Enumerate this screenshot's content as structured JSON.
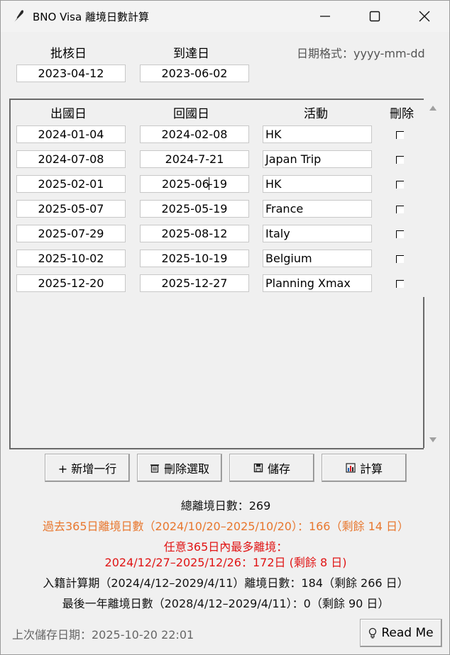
{
  "window": {
    "title": "BNO Visa 離境日數計算"
  },
  "header": {
    "approval_label": "批核日",
    "arrival_label": "到達日",
    "date_format_hint": "日期格式：yyyy-mm-dd",
    "approval_date": "2023-04-12",
    "arrival_date": "2023-06-02"
  },
  "table": {
    "columns": [
      "出國日",
      "回國日",
      "活動",
      "刪除"
    ],
    "rows": [
      {
        "depart": "2024-01-04",
        "return": "2024-02-08",
        "activity": "HK"
      },
      {
        "depart": "2024-07-08",
        "return": "2024-7-21",
        "activity": "Japan Trip"
      },
      {
        "depart": "2025-02-01",
        "return_a": "2025-06",
        "return_b": "19",
        "activity": "HK"
      },
      {
        "depart": "2025-05-07",
        "return": "2025-05-19",
        "activity": "France"
      },
      {
        "depart": "2025-07-29",
        "return": "2025-08-12",
        "activity": "Italy"
      },
      {
        "depart": "2025-10-02",
        "return": "2025-10-19",
        "activity": "Belgium"
      },
      {
        "depart": "2025-12-20",
        "return": "2025-12-27",
        "activity": "Planning Xmax"
      }
    ]
  },
  "buttons": {
    "add_row": "+ 新增一行",
    "delete_selected": "刪除選取",
    "save": "儲存",
    "calculate": "計算",
    "readme": "Read Me"
  },
  "stats": {
    "total": "總離境日數：269",
    "last365": "過去365日離境日數（2024/10/20–2025/10/20）：166（剩餘 14 日）",
    "max365_title": "任意365日內最多離境：",
    "max365_value": "2024/12/27–2025/12/26：172日 (剩餘 8 日)",
    "naturalisation": "入籍計算期（2024/4/12–2029/4/11）離境日數：184（剩餘 266 日）",
    "last_year": "最後一年離境日數（2028/4/12–2029/4/11）：0（剩餘 90 日）"
  },
  "footer": {
    "last_saved": "上次儲存日期：2025-10-20 22:01"
  },
  "colors": {
    "orange": "#e8772e",
    "red": "#e01414"
  }
}
